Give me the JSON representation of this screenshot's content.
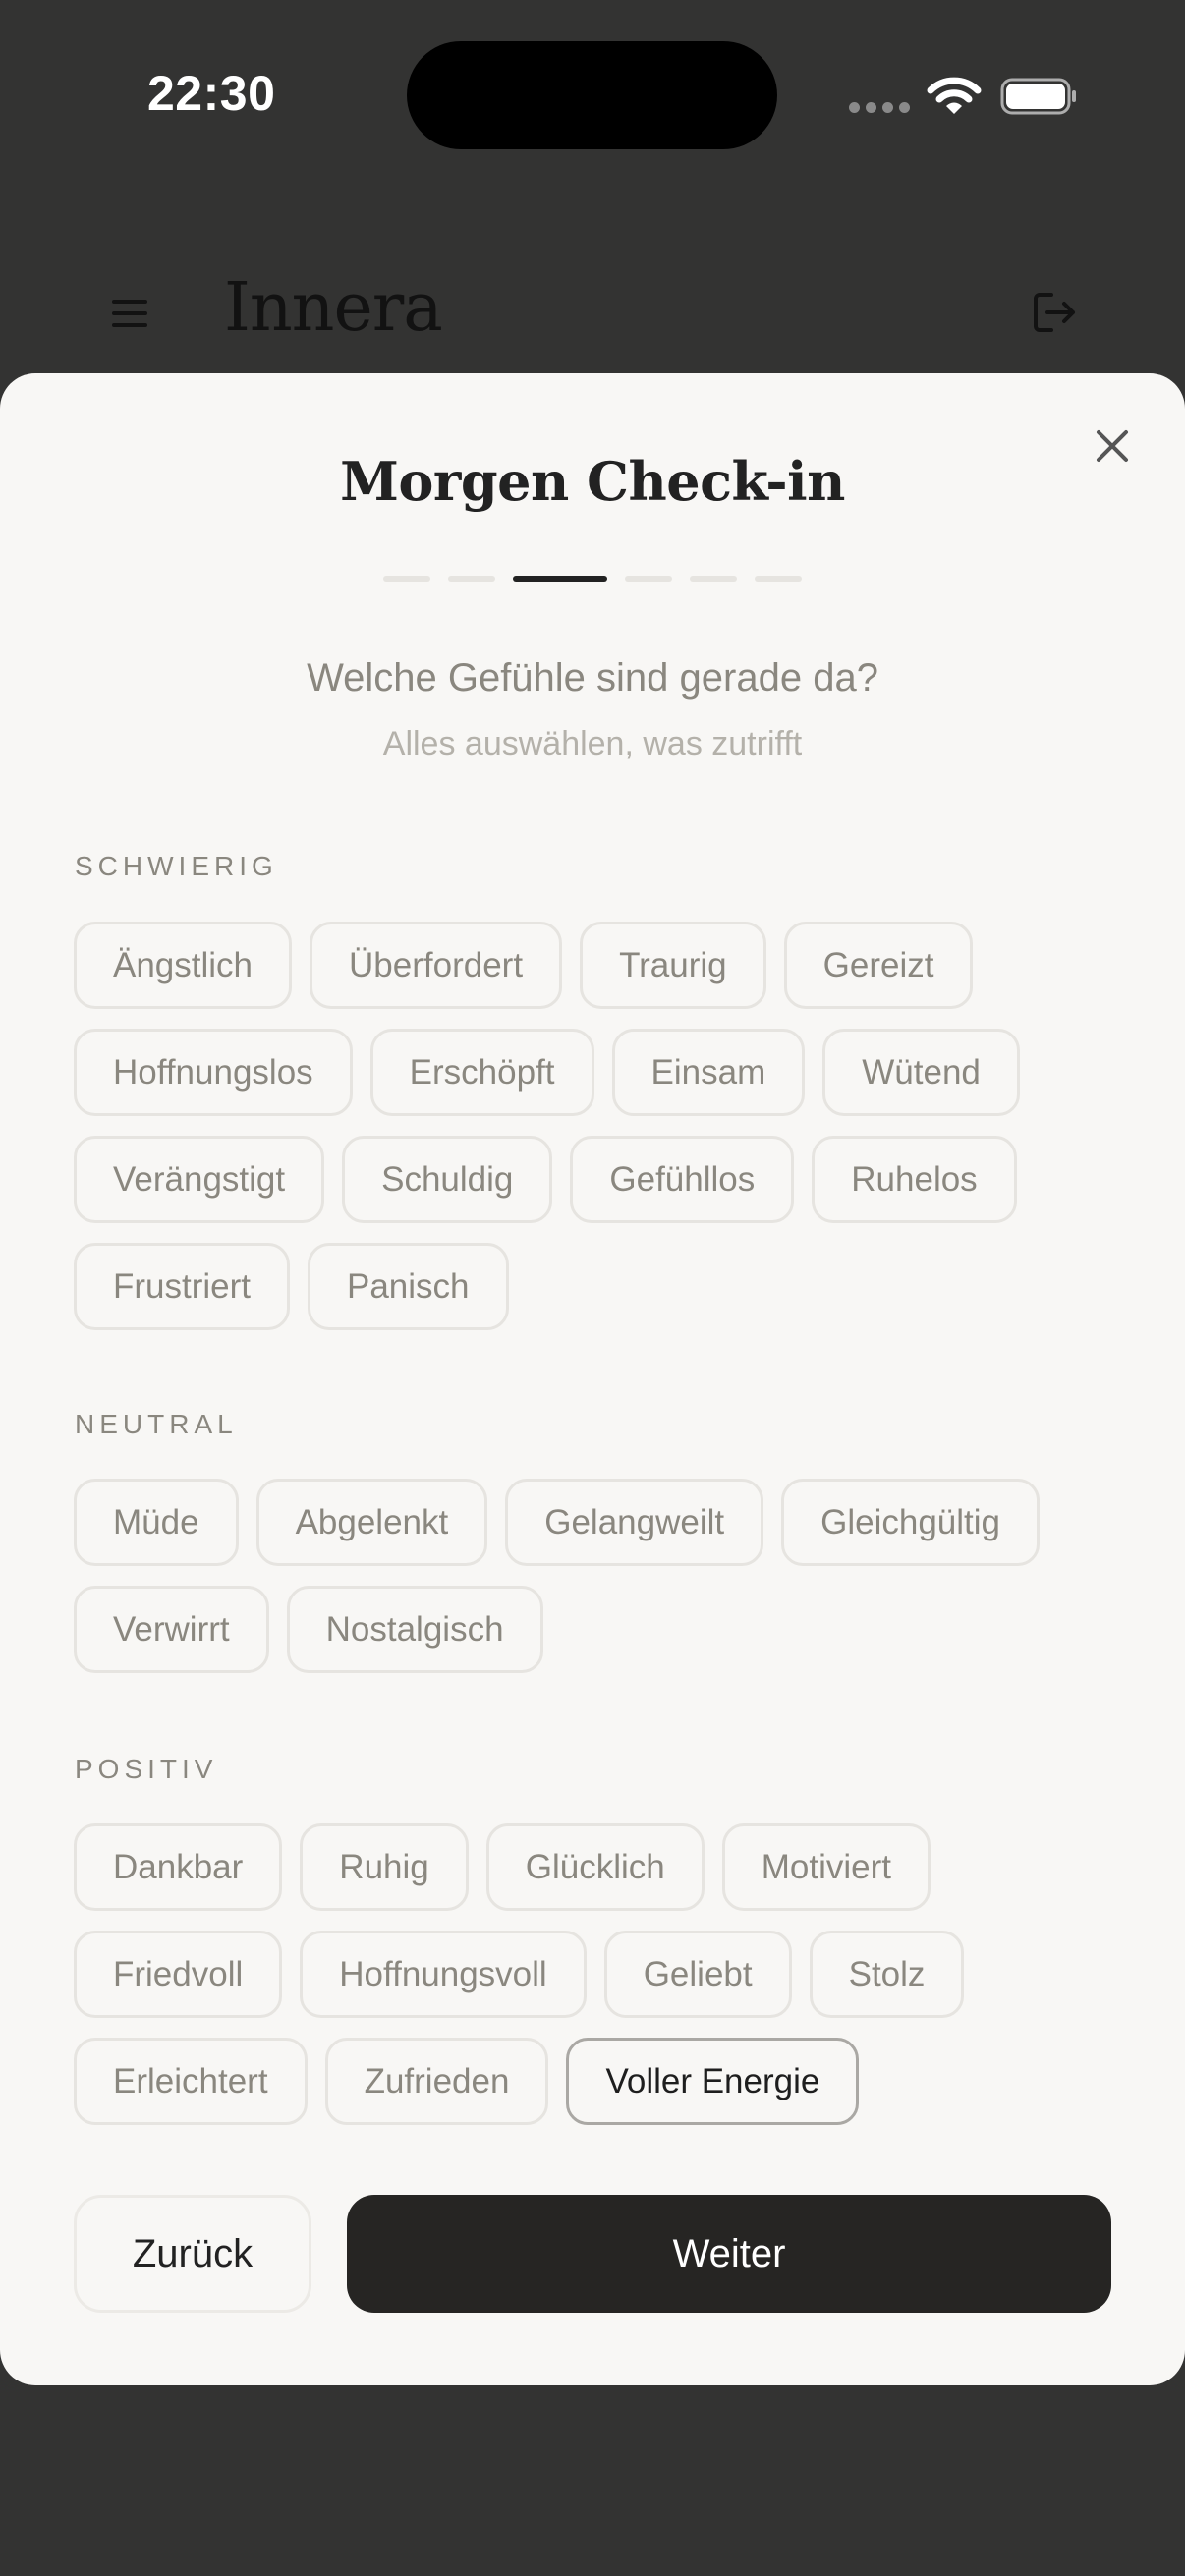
{
  "status_bar": {
    "time": "22:30"
  },
  "app_header": {
    "brand": "Innera"
  },
  "sheet": {
    "title": "Morgen Check-in",
    "progress": {
      "total_steps": 6,
      "current_step": 3
    },
    "question": "Welche Gefühle sind gerade da?",
    "hint": "Alles auswählen, was zutrifft",
    "sections": [
      {
        "label": "SCHWIERIG",
        "chips": [
          "Ängstlich",
          "Überfordert",
          "Traurig",
          "Gereizt",
          "Hoffnungslos",
          "Erschöpft",
          "Einsam",
          "Wütend",
          "Verängstigt",
          "Schuldig",
          "Gefühllos",
          "Ruhelos",
          "Frustriert",
          "Panisch"
        ]
      },
      {
        "label": "NEUTRAL",
        "chips": [
          "Müde",
          "Abgelenkt",
          "Gelangweilt",
          "Gleichgültig",
          "Verwirrt",
          "Nostalgisch"
        ]
      },
      {
        "label": "POSITIV",
        "chips": [
          "Dankbar",
          "Ruhig",
          "Glücklich",
          "Motiviert",
          "Friedvoll",
          "Hoffnungsvoll",
          "Geliebt",
          "Stolz",
          "Erleichtert",
          "Zufrieden",
          "Voller Energie"
        ]
      }
    ],
    "selected": [
      "Voller Energie"
    ],
    "buttons": {
      "back": "Zurück",
      "next": "Weiter"
    }
  }
}
